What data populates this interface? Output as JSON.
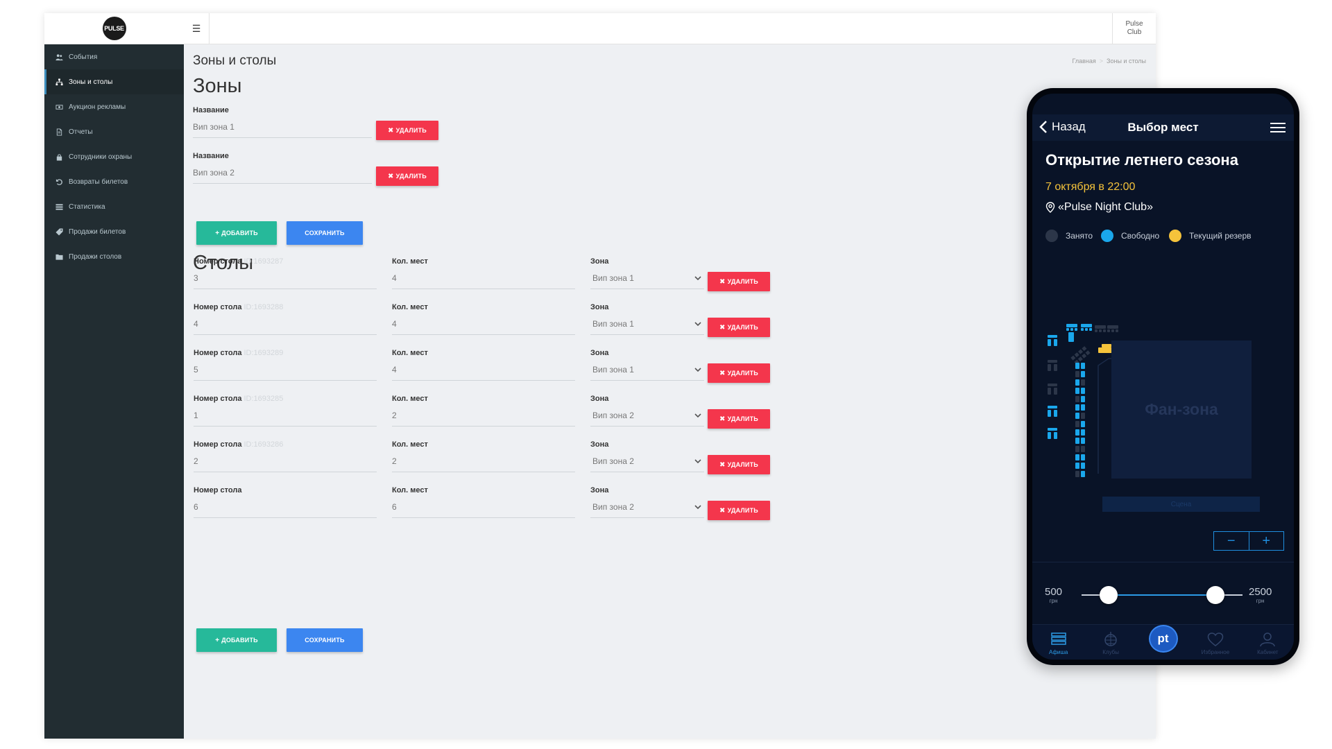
{
  "sidebar": {
    "items": [
      {
        "label": "События",
        "icon": "users-icon"
      },
      {
        "label": "Зоны и столы",
        "icon": "sitemap-icon",
        "active": true
      },
      {
        "label": "Аукцион рекламы",
        "icon": "money-icon"
      },
      {
        "label": "Отчеты",
        "icon": "file-icon"
      },
      {
        "label": "Сотрудники охраны",
        "icon": "lock-icon"
      },
      {
        "label": "Возвраты билетов",
        "icon": "undo-icon"
      },
      {
        "label": "Статистика",
        "icon": "list-icon"
      },
      {
        "label": "Продажи билетов",
        "icon": "tag-icon"
      },
      {
        "label": "Продажи столов",
        "icon": "folder-icon"
      }
    ]
  },
  "topbar": {
    "club_line1": "Pulse",
    "club_line2": "Club"
  },
  "page": {
    "title": "Зоны и столы",
    "breadcrumb": {
      "home": "Главная",
      "current": "Зоны и столы"
    }
  },
  "zones": {
    "heading": "Зоны",
    "name_label": "Название",
    "items": [
      {
        "value": "Вип зона 1"
      },
      {
        "value": "Вип зона 2"
      }
    ],
    "delete_label": "УДАЛИТЬ",
    "add_label": "ДОБАВИТЬ",
    "save_label": "СОХРАНИТЬ"
  },
  "tables": {
    "heading": "Столы",
    "number_label": "Номер стола",
    "seats_label": "Кол. мест",
    "zone_label": "Зона",
    "delete_label": "УДАЛИТЬ",
    "add_label": "ДОБАВИТЬ",
    "save_label": "СОХРАНИТЬ",
    "rows": [
      {
        "id": "ID:1693287",
        "number": "3",
        "seats": "4",
        "zone": "Вип зона 1"
      },
      {
        "id": "ID:1693288",
        "number": "4",
        "seats": "4",
        "zone": "Вип зона 1"
      },
      {
        "id": "ID:1693289",
        "number": "5",
        "seats": "4",
        "zone": "Вип зона 1"
      },
      {
        "id": "ID:1693285",
        "number": "1",
        "seats": "2",
        "zone": "Вип зона 2"
      },
      {
        "id": "ID:1693286",
        "number": "2",
        "seats": "2",
        "zone": "Вип зона 2"
      },
      {
        "id": "",
        "number": "6",
        "seats": "6",
        "zone": "Вип зона 2"
      }
    ]
  },
  "phone": {
    "back_label": "Назад",
    "title": "Выбор мест",
    "event_title": "Открытие летнего сезона",
    "date": "7 октября в 22:00",
    "venue": "«Pulse Night Club»",
    "legend": [
      {
        "label": "Занято",
        "color": "#2c3649"
      },
      {
        "label": "Свободно",
        "color": "#1aa7ec"
      },
      {
        "label": "Текущий резерв",
        "color": "#f5c33b"
      }
    ],
    "fanzone_label": "Фан-зона",
    "stage_label": "Сцена",
    "price_min": "500",
    "price_max": "2500",
    "price_unit": "грн",
    "price_range_low_fraction": 0.17,
    "price_range_high_fraction": 0.83,
    "tabs": [
      {
        "label": "Афиша",
        "icon": "poster-icon",
        "active": true
      },
      {
        "label": "Клубы",
        "icon": "disco-ball-icon"
      },
      {
        "label": "",
        "icon": "pt-logo-icon"
      },
      {
        "label": "Избранное",
        "icon": "heart-icon"
      },
      {
        "label": "Кабинет",
        "icon": "user-icon"
      }
    ],
    "colors": {
      "free": "#1aa7ec",
      "taken": "#2c3649",
      "reserved": "#f5c33b",
      "accent": "#2c9be6"
    }
  }
}
